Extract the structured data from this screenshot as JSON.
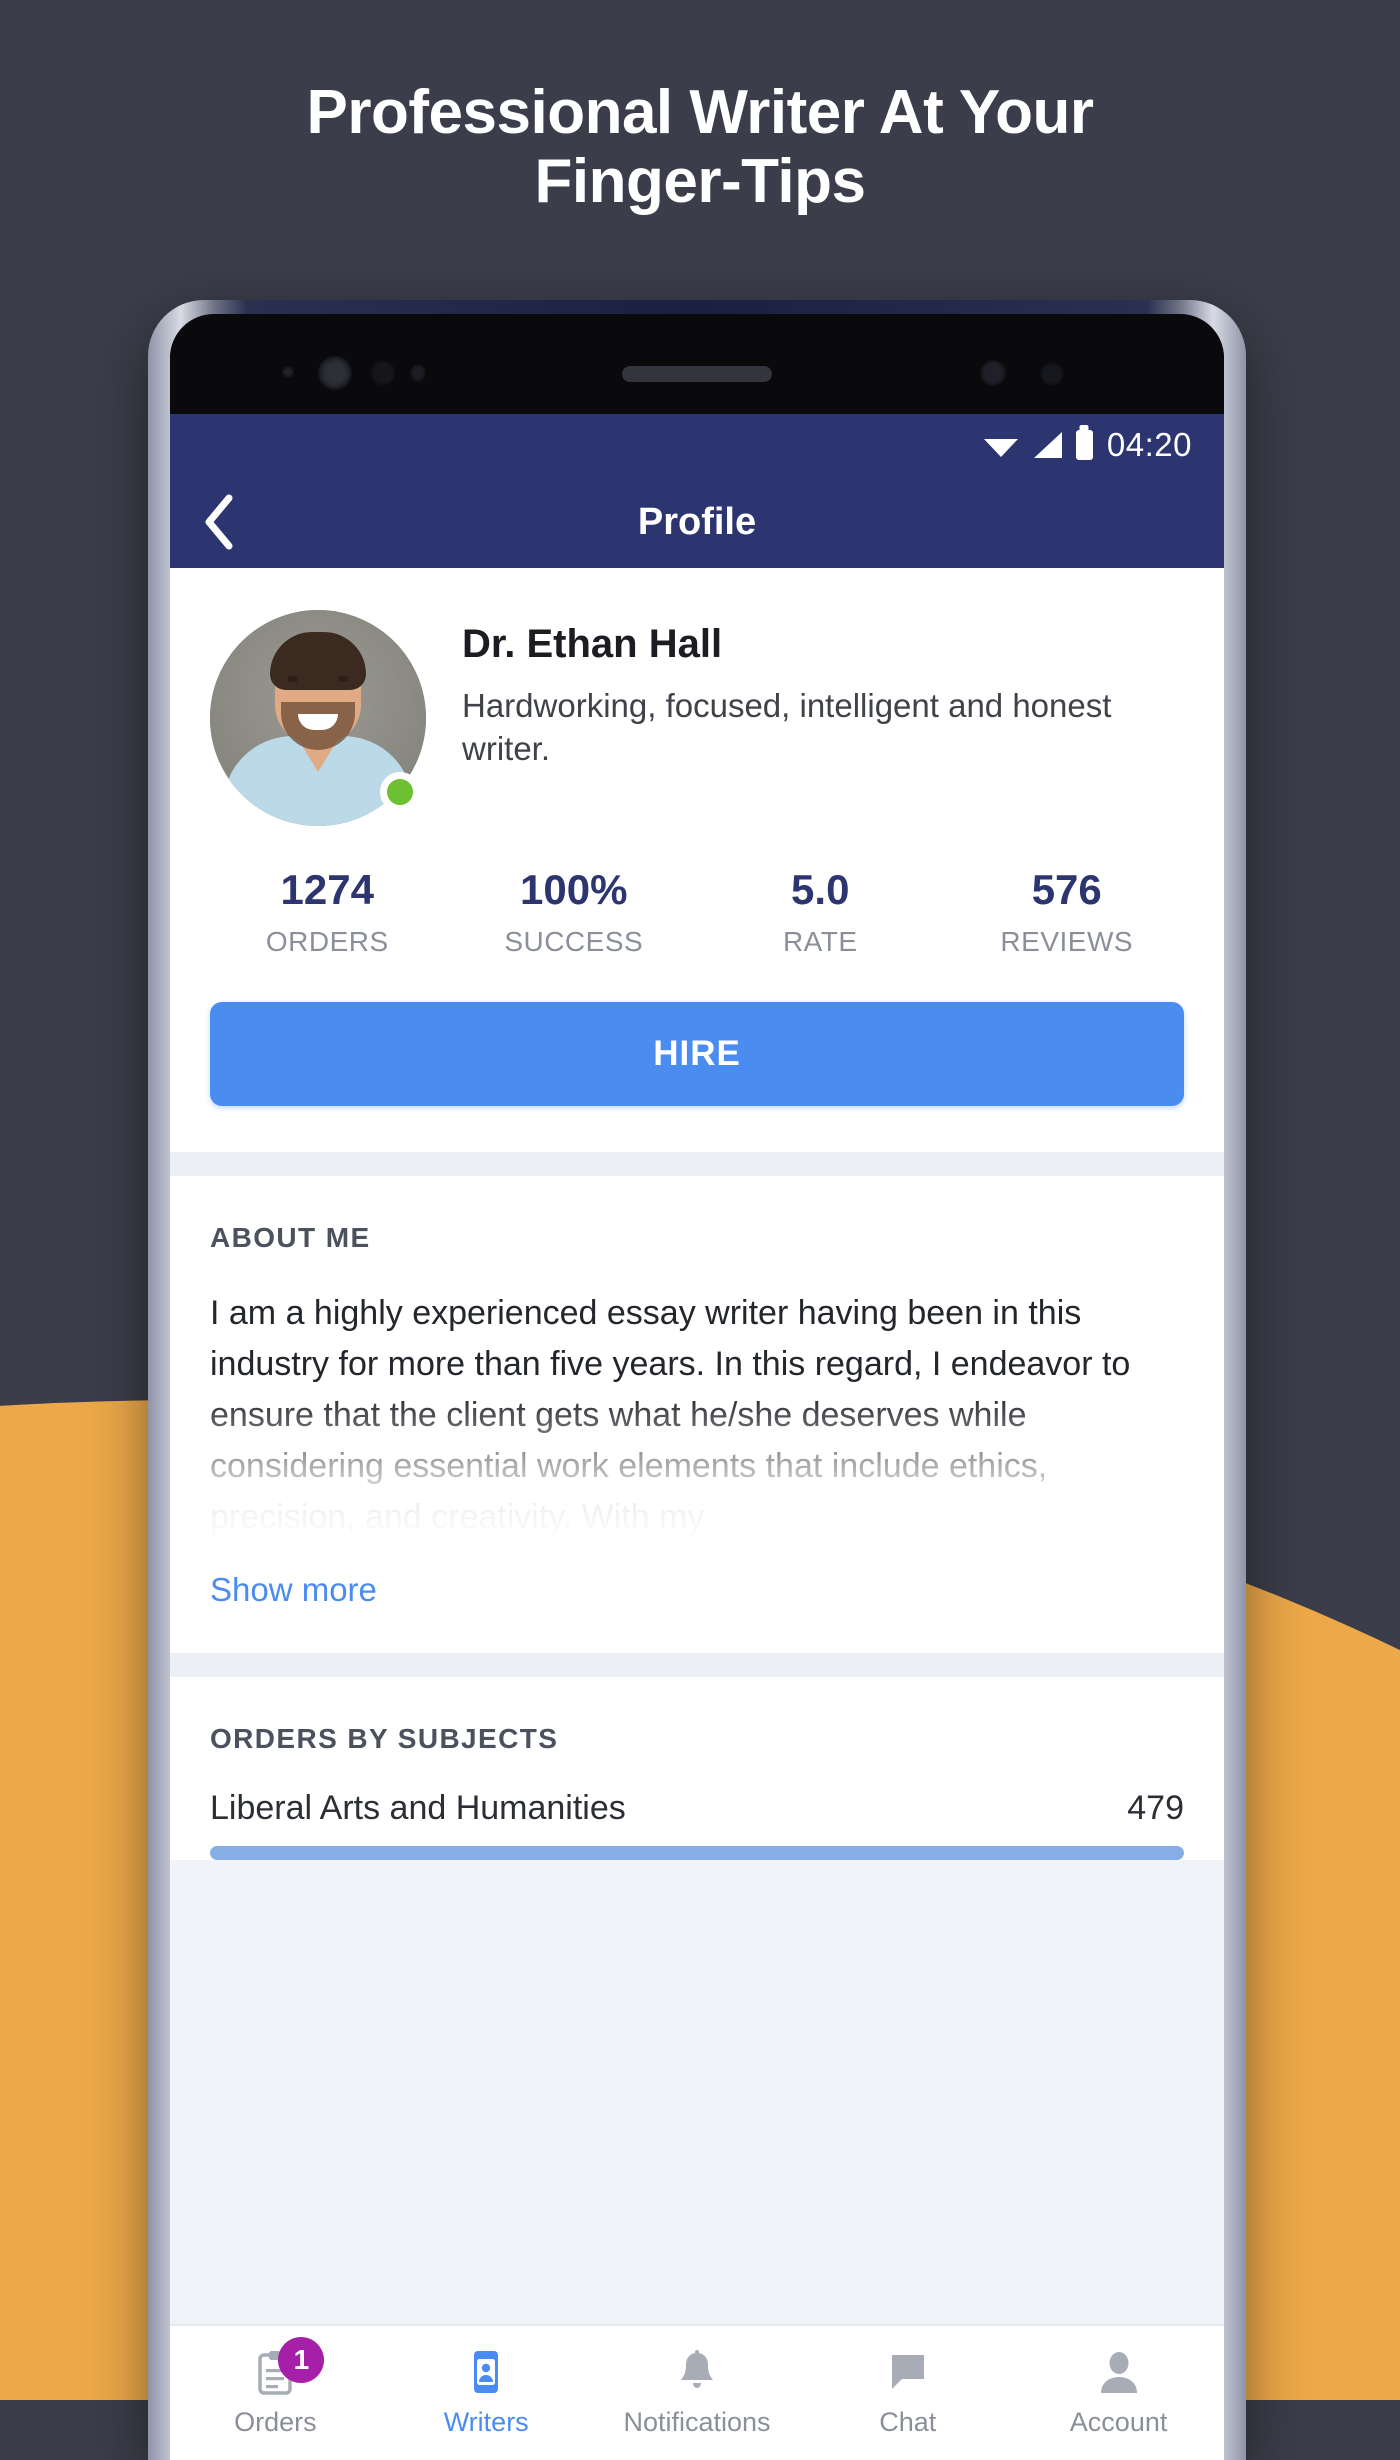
{
  "headline": {
    "line1": "Professional Writer At Your",
    "line2": "Finger-Tips"
  },
  "colors": {
    "background_dark": "#3b3d4a",
    "background_orange": "#eda949",
    "appbar_navy": "#2c3570",
    "accent_blue": "#4a8cf0",
    "badge_magenta": "#a61fa8",
    "online_green": "#6cc031"
  },
  "status_bar": {
    "time": "04:20",
    "icons": [
      "wifi-icon",
      "cellular-signal-icon",
      "battery-icon"
    ]
  },
  "app_bar": {
    "back_icon": "chevron-left-icon",
    "title": "Profile"
  },
  "profile": {
    "avatar_alt": "avatar",
    "online": true,
    "name": "Dr. Ethan Hall",
    "bio": "Hardworking, focused, intelligent and honest writer.",
    "stats": [
      {
        "value": "1274",
        "label": "ORDERS"
      },
      {
        "value": "100%",
        "label": "SUCCESS"
      },
      {
        "value": "5.0",
        "label": "RATE"
      },
      {
        "value": "576",
        "label": "REVIEWS"
      }
    ],
    "hire_label": "HIRE"
  },
  "about": {
    "title": "ABOUT ME",
    "text": "I am a highly experienced essay writer having been in this industry for more than five years. In this regard, I endeavor to ensure that the client gets what he/she deserves while considering essential work elements that include ethics, precision, and creativity. With my",
    "show_more_label": "Show more"
  },
  "subjects": {
    "title": "ORDERS BY SUBJECTS",
    "rows": [
      {
        "name": "Liberal Arts and Humanities",
        "count": "479",
        "percent": 100
      }
    ]
  },
  "bottom_nav": {
    "items": [
      {
        "label": "Orders",
        "icon": "clipboard-icon",
        "active": false,
        "badge": "1"
      },
      {
        "label": "Writers",
        "icon": "contact-card-icon",
        "active": true,
        "badge": ""
      },
      {
        "label": "Notifications",
        "icon": "bell-icon",
        "active": false,
        "badge": ""
      },
      {
        "label": "Chat",
        "icon": "chat-bubble-icon",
        "active": false,
        "badge": ""
      },
      {
        "label": "Account",
        "icon": "person-icon",
        "active": false,
        "badge": ""
      }
    ]
  }
}
